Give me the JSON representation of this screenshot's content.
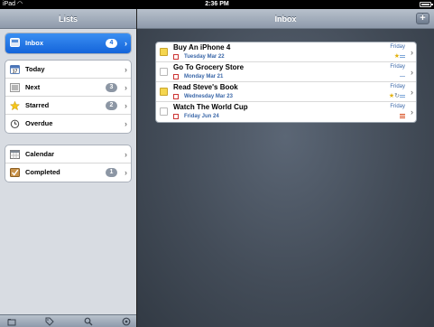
{
  "status_bar": {
    "carrier": "iPad",
    "time": "2:36 PM",
    "battery_level": 0.85
  },
  "left_pane": {
    "title": "Lists",
    "groups": [
      [
        {
          "label": "Inbox",
          "count": "4",
          "icon": "inbox-tray-icon",
          "selected": true
        }
      ],
      [
        {
          "label": "Today",
          "count": "",
          "icon": "calendar-day-icon"
        },
        {
          "label": "Next",
          "count": "3",
          "icon": "list-lines-icon"
        },
        {
          "label": "Starred",
          "count": "2",
          "icon": "star-icon"
        },
        {
          "label": "Overdue",
          "count": "",
          "icon": "alarm-clock-icon"
        }
      ],
      [
        {
          "label": "Calendar",
          "count": "",
          "icon": "calendar-icon"
        },
        {
          "label": "Completed",
          "count": "1",
          "icon": "checkmark-notebook-icon"
        }
      ]
    ],
    "toolbar": [
      "folders-icon",
      "tag-icon",
      "search-icon",
      "settings-icon"
    ]
  },
  "right_pane": {
    "title": "Inbox",
    "add_button": "+",
    "tasks": [
      {
        "title": "Buy An iPhone 4",
        "date": "Tuesday Mar 22",
        "due": "Friday",
        "checkbox_color": "#f5d64f",
        "starred": true,
        "repeat": false,
        "priority": "low"
      },
      {
        "title": "Go To Grocery Store",
        "date": "Monday Mar 21",
        "due": "Friday",
        "checkbox_color": "#ffffff",
        "starred": false,
        "repeat": false,
        "priority": "none"
      },
      {
        "title": "Read Steve's Book",
        "date": "Wednesday Mar 23",
        "due": "Friday",
        "checkbox_color": "#f5d64f",
        "starred": true,
        "repeat": true,
        "priority": "low"
      },
      {
        "title": "Watch The World Cup",
        "date": "Friday Jun 24",
        "due": "Friday",
        "checkbox_color": "#ffffff",
        "starred": false,
        "repeat": false,
        "priority": "high"
      }
    ]
  },
  "colors": {
    "selection_blue": "#1a6bdd",
    "date_blue": "#3a67a8",
    "star_yellow": "#e3b20e",
    "priority_red": "#d74a1b"
  }
}
